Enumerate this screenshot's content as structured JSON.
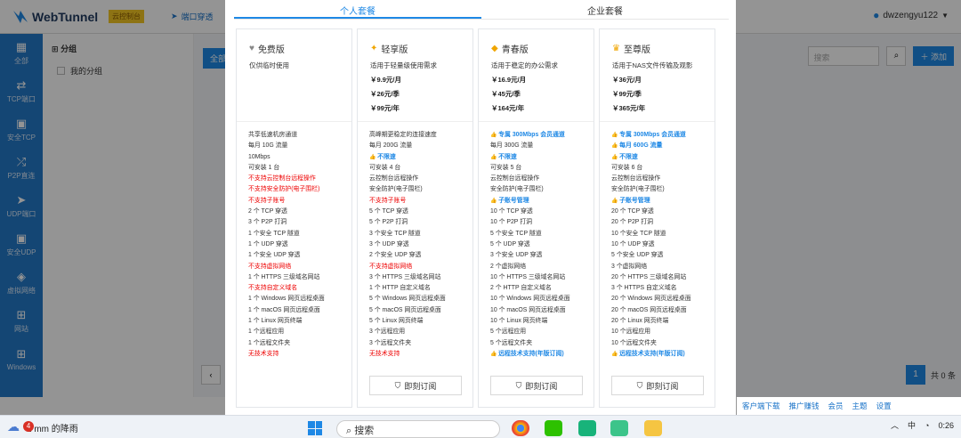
{
  "app": {
    "name": "WebTunnel",
    "badge": "云控制台"
  },
  "topnav": {
    "item1": "端口穿透"
  },
  "user": {
    "name": "dwzengyu122"
  },
  "sidebar": [
    {
      "label": "全部",
      "icon": "grid-icon"
    },
    {
      "label": "TCP端口",
      "icon": "arrows-icon"
    },
    {
      "label": "安全TCP",
      "icon": "lock-icon"
    },
    {
      "label": "P2P直连",
      "icon": "shuffle-icon"
    },
    {
      "label": "UDP端口",
      "icon": "send-icon"
    },
    {
      "label": "安全UDP",
      "icon": "lock-icon"
    },
    {
      "label": "虚拟网络",
      "icon": "network-icon"
    },
    {
      "label": "网站",
      "icon": "sitemap-icon"
    },
    {
      "label": "Windows",
      "icon": "windows-icon"
    }
  ],
  "groups": {
    "header": "分组",
    "item": "我的分组",
    "all_btn": "全部"
  },
  "toolbar": {
    "search_placeholder": "搜索",
    "add": "添加"
  },
  "pager": {
    "current": "1",
    "total": "共 0 条"
  },
  "tabs": [
    "个人套餐",
    "企业套餐"
  ],
  "plans": [
    {
      "name": "免费版",
      "icon": "heart-icon",
      "desc": "仅供临时使用",
      "prices": [],
      "features": [
        {
          "t": "共享低速机房通道",
          "s": "n"
        },
        {
          "t": "每月 10G 流量",
          "s": "n"
        },
        {
          "t": "10Mbps",
          "s": "n"
        },
        {
          "t": "可安装 1 台",
          "s": "n"
        },
        {
          "t": "不支持云控制台远程操作",
          "s": "r"
        },
        {
          "t": "不支持安全防护(电子围栏)",
          "s": "r"
        },
        {
          "t": "不支持子账号",
          "s": "r"
        },
        {
          "t": "2 个 TCP 穿透",
          "s": "n"
        },
        {
          "t": "3 个 P2P 打洞",
          "s": "n"
        },
        {
          "t": "1 个安全 TCP 隧道",
          "s": "n"
        },
        {
          "t": "1 个 UDP 穿透",
          "s": "n"
        },
        {
          "t": "1 个安全 UDP 穿透",
          "s": "n"
        },
        {
          "t": "不支持虚拟网络",
          "s": "r"
        },
        {
          "t": "1 个 HTTPS 三级域名网站",
          "s": "n"
        },
        {
          "t": "不支持自定义域名",
          "s": "r"
        },
        {
          "t": "1 个 Windows 网页远程桌面",
          "s": "n"
        },
        {
          "t": "1 个 macOS 网页远程桌面",
          "s": "n"
        },
        {
          "t": "1 个 Linux 网页终端",
          "s": "n"
        },
        {
          "t": "1 个远程应用",
          "s": "n"
        },
        {
          "t": "1 个远程文件夹",
          "s": "n"
        },
        {
          "t": "无技术支持",
          "s": "r"
        }
      ]
    },
    {
      "name": "轻享版",
      "icon": "vip-icon",
      "desc": "适用于轻量级使用需求",
      "prices": [
        "￥9.9元/月",
        "￥26元/季",
        "￥99元/年"
      ],
      "features": [
        {
          "t": "高峰期更稳定的连接速度",
          "s": "n"
        },
        {
          "t": "每月 200G 流量",
          "s": "n"
        },
        {
          "t": "不限速",
          "s": "b"
        },
        {
          "t": "可安装 4 台",
          "s": "n"
        },
        {
          "t": "云控制台远程操作",
          "s": "n"
        },
        {
          "t": "安全防护(电子围栏)",
          "s": "n"
        },
        {
          "t": "不支持子账号",
          "s": "r"
        },
        {
          "t": "5 个 TCP 穿透",
          "s": "n"
        },
        {
          "t": "5 个 P2P 打洞",
          "s": "n"
        },
        {
          "t": "3 个安全 TCP 隧道",
          "s": "n"
        },
        {
          "t": "3 个 UDP 穿透",
          "s": "n"
        },
        {
          "t": "2 个安全 UDP 穿透",
          "s": "n"
        },
        {
          "t": "不支持虚拟网络",
          "s": "r"
        },
        {
          "t": "3 个 HTTPS 三级域名网站",
          "s": "n"
        },
        {
          "t": "1 个 HTTP 自定义域名",
          "s": "n"
        },
        {
          "t": "5 个 Windows 网页远程桌面",
          "s": "n"
        },
        {
          "t": "5 个 macOS 网页远程桌面",
          "s": "n"
        },
        {
          "t": "5 个 Linux 网页终端",
          "s": "n"
        },
        {
          "t": "3 个远程应用",
          "s": "n"
        },
        {
          "t": "3 个远程文件夹",
          "s": "n"
        },
        {
          "t": "无技术支持",
          "s": "r"
        }
      ]
    },
    {
      "name": "青春版",
      "icon": "shield-icon",
      "desc": "适用于稳定的办公需求",
      "prices": [
        "￥16.9元/月",
        "￥45元/季",
        "￥164元/年"
      ],
      "features": [
        {
          "t": "专属 300Mbps 会员通道",
          "s": "b"
        },
        {
          "t": "每月 300G 流量",
          "s": "n"
        },
        {
          "t": "不限速",
          "s": "b"
        },
        {
          "t": "可安装 5 台",
          "s": "n"
        },
        {
          "t": "云控制台远程操作",
          "s": "n"
        },
        {
          "t": "安全防护(电子围栏)",
          "s": "n"
        },
        {
          "t": "子账号管理",
          "s": "b"
        },
        {
          "t": "10 个 TCP 穿透",
          "s": "n"
        },
        {
          "t": "10 个 P2P 打洞",
          "s": "n"
        },
        {
          "t": "5 个安全 TCP 隧道",
          "s": "n"
        },
        {
          "t": "5 个 UDP 穿透",
          "s": "n"
        },
        {
          "t": "3 个安全 UDP 穿透",
          "s": "n"
        },
        {
          "t": "2 个虚拟网络",
          "s": "n"
        },
        {
          "t": "10 个 HTTPS 三级域名网站",
          "s": "n"
        },
        {
          "t": "2 个 HTTP 自定义域名",
          "s": "n"
        },
        {
          "t": "10 个 Windows 网页远程桌面",
          "s": "n"
        },
        {
          "t": "10 个 macOS 网页远程桌面",
          "s": "n"
        },
        {
          "t": "10 个 Linux 网页终端",
          "s": "n"
        },
        {
          "t": "5 个远程应用",
          "s": "n"
        },
        {
          "t": "5 个远程文件夹",
          "s": "n"
        },
        {
          "t": "远程技术支持(年版订阅)",
          "s": "b"
        }
      ]
    },
    {
      "name": "至尊版",
      "icon": "crown-icon",
      "desc": "适用于NAS文件传输及观影",
      "prices": [
        "￥36元/月",
        "￥99元/季",
        "￥365元/年"
      ],
      "features": [
        {
          "t": "专属 300Mbps 会员通道",
          "s": "b"
        },
        {
          "t": "每月 600G 流量",
          "s": "b"
        },
        {
          "t": "不限速",
          "s": "b"
        },
        {
          "t": "可安装 6 台",
          "s": "n"
        },
        {
          "t": "云控制台远程操作",
          "s": "n"
        },
        {
          "t": "安全防护(电子围栏)",
          "s": "n"
        },
        {
          "t": "子账号管理",
          "s": "b"
        },
        {
          "t": "20 个 TCP 穿透",
          "s": "n"
        },
        {
          "t": "20 个 P2P 打洞",
          "s": "n"
        },
        {
          "t": "10 个安全 TCP 隧道",
          "s": "n"
        },
        {
          "t": "10 个 UDP 穿透",
          "s": "n"
        },
        {
          "t": "5 个安全 UDP 穿透",
          "s": "n"
        },
        {
          "t": "3 个虚拟网络",
          "s": "n"
        },
        {
          "t": "20 个 HTTPS 三级域名网站",
          "s": "n"
        },
        {
          "t": "3 个 HTTPS 自定义域名",
          "s": "n"
        },
        {
          "t": "20 个 Windows 网页远程桌面",
          "s": "n"
        },
        {
          "t": "20 个 macOS 网页远程桌面",
          "s": "n"
        },
        {
          "t": "20 个 Linux 网页终端",
          "s": "n"
        },
        {
          "t": "10 个远程应用",
          "s": "n"
        },
        {
          "t": "10 个远程文件夹",
          "s": "n"
        },
        {
          "t": "远程技术支持(年版订阅)",
          "s": "b"
        }
      ]
    }
  ],
  "subscribe_label": "即刻订阅",
  "bottom_links": [
    "客户端下载",
    "推广赚钱",
    "会员",
    "主题",
    "设置"
  ],
  "taskbar": {
    "weather_count": "4",
    "weather": "1 mm 的降雨",
    "search": "搜索",
    "time": "0:26"
  }
}
